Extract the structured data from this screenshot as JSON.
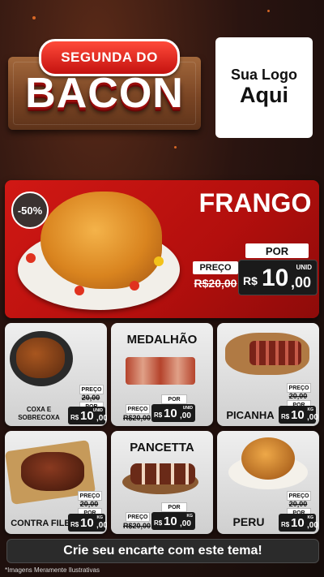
{
  "header": {
    "ribbon_text": "SEGUNDA DO",
    "main_title": "BACON",
    "logo_line1": "Sua Logo",
    "logo_line2": "Aqui"
  },
  "hero": {
    "discount": "-50%",
    "product": "FRANGO",
    "por_label": "POR",
    "preco_label": "PREÇO",
    "old_price": "R$20,00",
    "currency": "R$",
    "price_int": "10",
    "price_dec": ",00",
    "unit": "UNID"
  },
  "products": [
    {
      "name": "COXA E SOBRECOXA",
      "preco_label": "PREÇO",
      "old_price": "20,00",
      "por_label": "POR",
      "currency": "R$",
      "price_int": "10",
      "price_dec": ",00",
      "unit": "UNID"
    },
    {
      "name": "MEDALHÃO",
      "preco_label": "PREÇO",
      "old_price": "R$20,00",
      "por_label": "POR",
      "currency": "R$",
      "price_int": "10",
      "price_dec": ",00",
      "unit": "UNID"
    },
    {
      "name": "PICANHA",
      "preco_label": "PREÇO",
      "old_price": "20,00",
      "por_label": "POR",
      "currency": "R$",
      "price_int": "10",
      "price_dec": ",00",
      "unit": "KG"
    },
    {
      "name": "CONTRA FILE",
      "preco_label": "PREÇO",
      "old_price": "20,00",
      "por_label": "POR",
      "currency": "R$",
      "price_int": "10",
      "price_dec": ",00",
      "unit": "KG"
    },
    {
      "name": "PANCETTA",
      "preco_label": "PREÇO",
      "old_price": "R$20,00",
      "por_label": "POR",
      "currency": "R$",
      "price_int": "10",
      "price_dec": ",00",
      "unit": "KG"
    },
    {
      "name": "PERU",
      "preco_label": "PREÇO",
      "old_price": "20,00",
      "por_label": "POR",
      "currency": "R$",
      "price_int": "10",
      "price_dec": ",00",
      "unit": "KG"
    }
  ],
  "footer": {
    "cta": "Crie seu encarte com este tema!",
    "disclaimer": "*Imagens Meramente Ilustrativas"
  },
  "colors": {
    "accent_red": "#c4120f",
    "price_box": "#1a1a1a",
    "background": "#1b1210"
  }
}
